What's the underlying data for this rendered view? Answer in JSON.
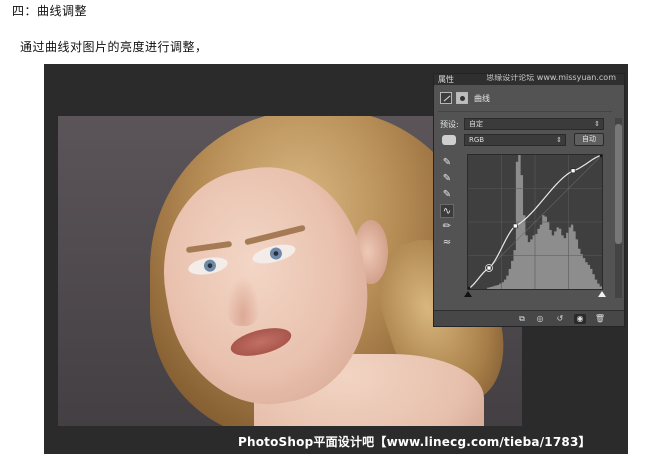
{
  "doc": {
    "heading": "四：曲线调整",
    "intro": "通过曲线对图片的亮度进行调整，"
  },
  "watermark": "PhotoShop平面设计吧【www.linecg.com/tieba/1783】",
  "panel": {
    "tab_label": "属性",
    "site_label": "思缘设计论坛 www.missyuan.com",
    "window_controls": "◂◂ ✕",
    "curves_label": "曲线",
    "preset_label": "预设:",
    "preset_value": "自定",
    "channel_value": "RGB",
    "auto_button": "自动",
    "tools": [
      {
        "icon": "eyedropper-black-icon",
        "glyph": "✎"
      },
      {
        "icon": "eyedropper-gray-icon",
        "glyph": "✎"
      },
      {
        "icon": "eyedropper-white-icon",
        "glyph": "✎"
      },
      {
        "icon": "curve-edit-icon",
        "glyph": "∿"
      },
      {
        "icon": "pencil-icon",
        "glyph": "✏"
      },
      {
        "icon": "smooth-icon",
        "glyph": "≈"
      }
    ],
    "bottom_icons": [
      {
        "icon": "clip-to-layer-icon",
        "glyph": "⧉"
      },
      {
        "icon": "view-previous-icon",
        "glyph": "◎"
      },
      {
        "icon": "reset-icon",
        "glyph": "↺"
      },
      {
        "icon": "visibility-eye-icon",
        "glyph": "◉"
      },
      {
        "icon": "delete-trash-icon",
        "glyph": "🗑"
      }
    ]
  },
  "curve": {
    "points": [
      [
        0,
        0
      ],
      [
        40,
        40
      ],
      [
        90,
        120
      ],
      [
        200,
        225
      ],
      [
        255,
        255
      ]
    ],
    "histogram": [
      0,
      0,
      0,
      0,
      0,
      0,
      0,
      0,
      2,
      3,
      4,
      5,
      6,
      8,
      10,
      14,
      20,
      30,
      42,
      58,
      190,
      200,
      170,
      110,
      80,
      70,
      74,
      80,
      82,
      90,
      96,
      110,
      108,
      100,
      88,
      80,
      86,
      92,
      90,
      80,
      76,
      84,
      92,
      96,
      86,
      74,
      60,
      52,
      46,
      40,
      36,
      30,
      22,
      14,
      8,
      4
    ]
  },
  "colors": {
    "panel_bg": "#535353",
    "graph_bg": "#3f3f3f",
    "histogram": "#8d8d8d",
    "curve_line": "#e8e8e8"
  }
}
